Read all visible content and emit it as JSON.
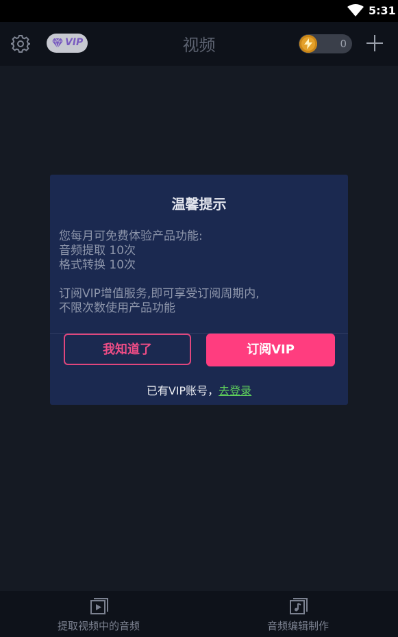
{
  "status_bar": {
    "time": "5:31",
    "wifi_icon": "wifi-icon"
  },
  "header": {
    "title": "视频",
    "vip_badge": "VIP",
    "coin_count": "0",
    "icons": [
      "gear-icon",
      "gem-icon",
      "lightning-icon",
      "plus-icon"
    ]
  },
  "dialog": {
    "title": "温馨提示",
    "message_lines": [
      "您每月可免费体验产品功能:",
      "音频提取 10次",
      "格式转换 10次",
      "",
      "订阅VIP增值服务,即可享受订阅周期内,",
      "不限次数使用产品功能"
    ],
    "cancel_label": "我知道了",
    "subscribe_label": "订阅VIP",
    "footer_text": "已有VIP账号，",
    "login_link": "去登录"
  },
  "bottom_nav": {
    "items": [
      {
        "label": "提取视频中的音频",
        "icon": "video-play-icon"
      },
      {
        "label": "音频编辑制作",
        "icon": "music-note-icon"
      }
    ]
  },
  "colors": {
    "accent": "#ff3d7f",
    "link": "#5fd05b",
    "dialog_bg": "#1b2950",
    "background": "#151a23"
  }
}
